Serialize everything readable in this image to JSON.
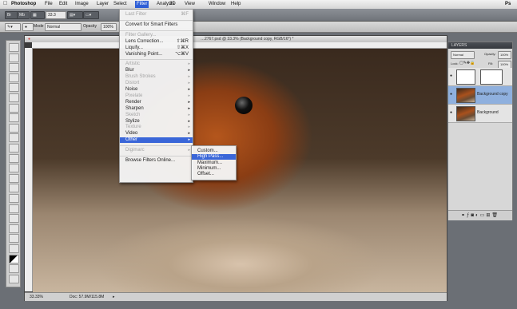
{
  "menubar": {
    "apple": "",
    "app": "Photoshop",
    "items": [
      "File",
      "Edit",
      "Image",
      "Layer",
      "Select",
      "Filter",
      "Analysis",
      "3D",
      "View",
      "Window",
      "Help"
    ],
    "active_index": 5,
    "right_icon": "Ps"
  },
  "appbar": {
    "zoom": "33.3",
    "icons": [
      "Br",
      "Mb",
      "grid",
      "screen"
    ]
  },
  "options": {
    "mode_label": "Mode",
    "mode_value": "Normal",
    "opacity_label": "Opacity",
    "opacity_value": "100%"
  },
  "document": {
    "title": "…2767.psd @ 33.3% (Background copy, RGB/16*) *",
    "zoom": "33.33%",
    "doc_info": "Doc: 57.9M/115.8M"
  },
  "layers_panel": {
    "title": "LAYERS",
    "blend": "Normal",
    "opacity_label": "Opacity:",
    "opacity": "100%",
    "lock_label": "Lock:",
    "fill_label": "Fill:",
    "fill": "100%",
    "layers": [
      {
        "name": "",
        "selected": false,
        "thumb": "white"
      },
      {
        "name": "Background copy",
        "selected": true,
        "thumb": "photo"
      },
      {
        "name": "Background",
        "selected": false,
        "thumb": "photo"
      }
    ]
  },
  "filter_menu": {
    "items": [
      {
        "label": "Last Filter",
        "shortcut": "⌘F",
        "disabled": true
      },
      {
        "sep": true
      },
      {
        "label": "Convert for Smart Filters"
      },
      {
        "sep": true
      },
      {
        "label": "Filter Gallery...",
        "disabled": true
      },
      {
        "label": "Lens Correction...",
        "shortcut": "⇧⌘R"
      },
      {
        "label": "Liquify...",
        "shortcut": "⇧⌘X"
      },
      {
        "label": "Vanishing Point...",
        "shortcut": "⌥⌘V"
      },
      {
        "sep": true
      },
      {
        "label": "Artistic",
        "disabled": true,
        "sub": true
      },
      {
        "label": "Blur",
        "sub": true
      },
      {
        "label": "Brush Strokes",
        "disabled": true,
        "sub": true
      },
      {
        "label": "Distort",
        "disabled": true,
        "sub": true
      },
      {
        "label": "Noise",
        "sub": true
      },
      {
        "label": "Pixelate",
        "disabled": true,
        "sub": true
      },
      {
        "label": "Render",
        "sub": true
      },
      {
        "label": "Sharpen",
        "sub": true
      },
      {
        "label": "Sketch",
        "disabled": true,
        "sub": true
      },
      {
        "label": "Stylize",
        "sub": true
      },
      {
        "label": "Texture",
        "disabled": true,
        "sub": true
      },
      {
        "label": "Video",
        "sub": true
      },
      {
        "label": "Other",
        "sub": true,
        "highlight": true
      },
      {
        "sep": true
      },
      {
        "label": "Digimarc",
        "disabled": true,
        "sub": true
      },
      {
        "sep": true
      },
      {
        "label": "Browse Filters Online..."
      }
    ]
  },
  "other_submenu": {
    "items": [
      {
        "label": "Custom..."
      },
      {
        "label": "High Pass...",
        "highlight": true
      },
      {
        "label": "Maximum..."
      },
      {
        "label": "Minimum..."
      },
      {
        "label": "Offset..."
      }
    ]
  },
  "tools": [
    "move",
    "marquee",
    "lasso",
    "quick-select",
    "crop",
    "eyedropper",
    "spot-heal",
    "brush",
    "clone",
    "history",
    "eraser",
    "gradient",
    "dodge",
    "pen",
    "type",
    "path-select",
    "shape",
    "3d-rotate",
    "3d-orbit",
    "hand",
    "zoom",
    "fg-bg",
    "quick-mask",
    "screen-mode"
  ]
}
